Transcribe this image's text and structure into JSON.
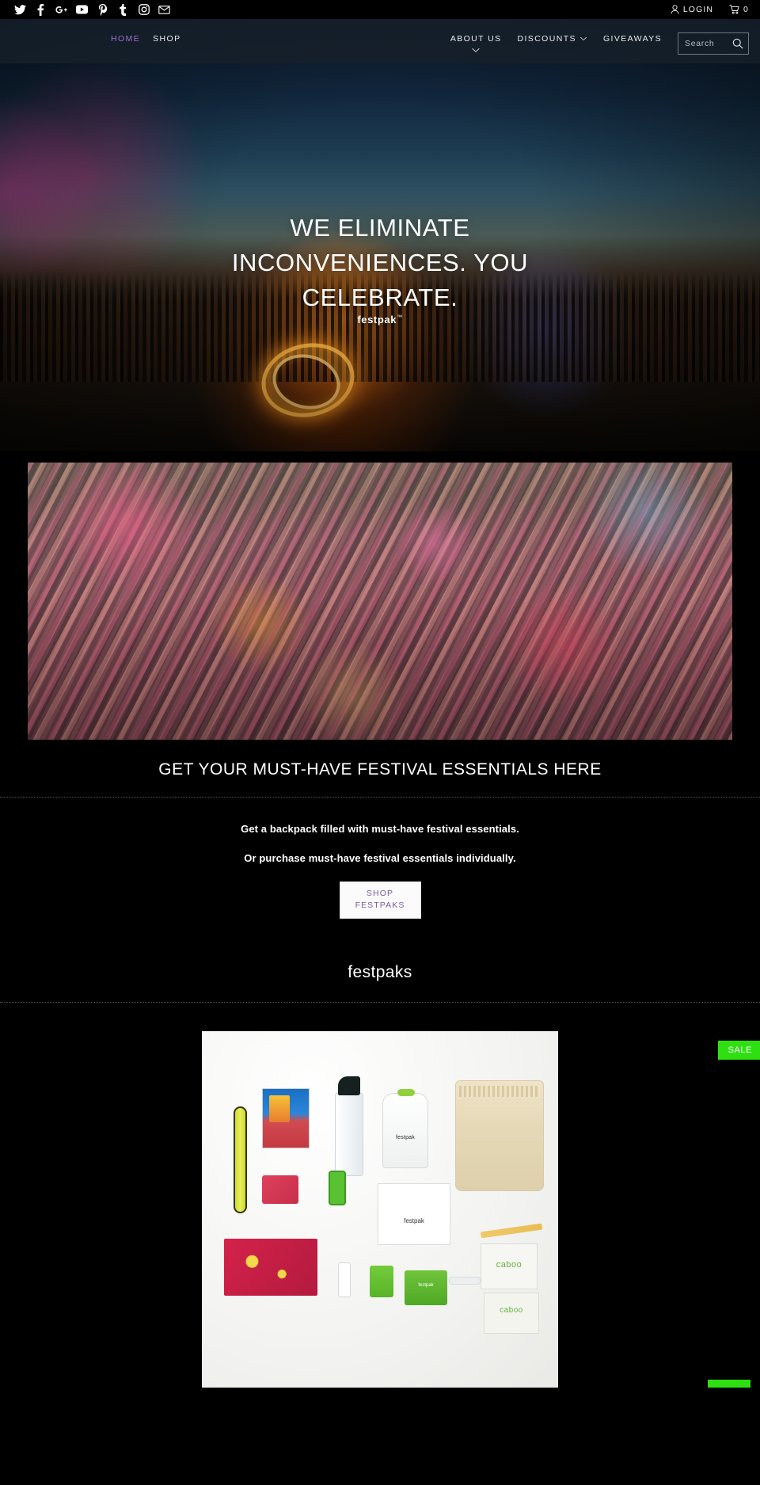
{
  "topbar": {
    "social": [
      {
        "name": "twitter-icon",
        "label": "Twitter"
      },
      {
        "name": "facebook-icon",
        "label": "Facebook"
      },
      {
        "name": "google-plus-icon",
        "label": "Google Plus"
      },
      {
        "name": "youtube-icon",
        "label": "YouTube"
      },
      {
        "name": "pinterest-icon",
        "label": "Pinterest"
      },
      {
        "name": "tumblr-icon",
        "label": "Tumblr"
      },
      {
        "name": "instagram-icon",
        "label": "Instagram"
      },
      {
        "name": "email-icon",
        "label": "Email"
      }
    ],
    "login_label": "LOGIN",
    "cart_count": "0"
  },
  "nav": {
    "left": [
      {
        "label": "HOME",
        "active": true
      },
      {
        "label": "SHOP",
        "active": false
      }
    ],
    "right": [
      {
        "label": "ABOUT US",
        "has_caret": true
      },
      {
        "label": "DISCOUNTS",
        "has_caret": true
      },
      {
        "label": "GIVEAWAYS",
        "has_caret": false
      }
    ]
  },
  "search": {
    "placeholder": "Search",
    "value": ""
  },
  "hero": {
    "headline": "WE ELIMINATE INCONVENIENCES. YOU CELEBRATE.",
    "brand": "festpak",
    "brand_tm": "™"
  },
  "feature": {
    "heading": "GET YOUR MUST-HAVE FESTIVAL ESSENTIALS HERE",
    "line1": "Get a backpack filled with must-have festival essentials.",
    "line2": "Or purchase must-have festival essentials individually.",
    "button_line1": "SHOP",
    "button_line2": "FESTPAKS"
  },
  "collection": {
    "heading": "festpaks",
    "badge": "SALE"
  },
  "colors": {
    "accent_purple": "#9b6fd4",
    "button_text": "#7a5aa8",
    "sale_green": "#2ee012",
    "background": "#000000"
  }
}
